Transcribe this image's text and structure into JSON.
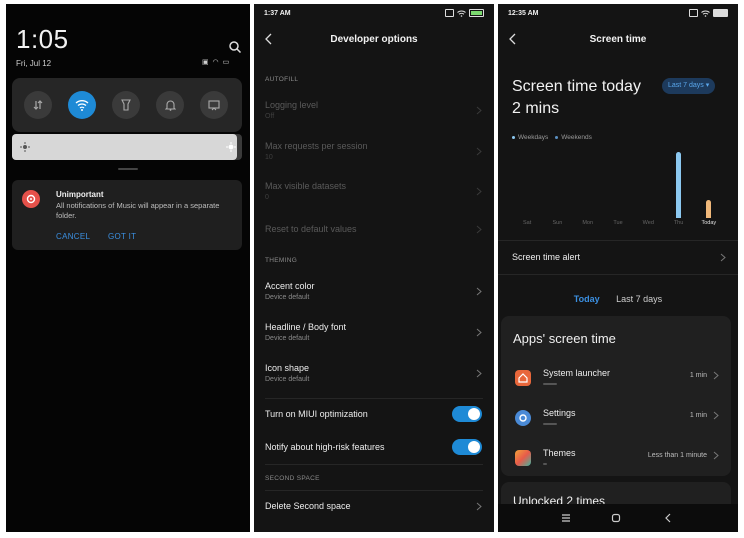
{
  "panel1": {
    "time": "1:05",
    "date": "Fri, Jul 12",
    "quick_settings": [
      "data-icon",
      "wifi-icon",
      "flashlight-icon",
      "bell-icon",
      "cast-icon"
    ],
    "brightness": 0.98,
    "notification": {
      "title": "Unimportant",
      "body": "All notifications of Music will appear in a separate folder.",
      "cancel": "CANCEL",
      "ok": "GOT IT"
    }
  },
  "panel2": {
    "status_time": "1:37 AM",
    "title": "Developer options",
    "autofill_header": "AUTOFILL",
    "logging_level": {
      "title": "Logging level",
      "sub": "Off"
    },
    "max_requests": {
      "title": "Max requests per session",
      "sub": "10"
    },
    "max_datasets": {
      "title": "Max visible datasets",
      "sub": "0"
    },
    "reset_defaults": "Reset to default values",
    "theming_header": "THEMING",
    "accent_color": {
      "title": "Accent color",
      "sub": "Device default"
    },
    "headline_font": {
      "title": "Headline / Body font",
      "sub": "Device default"
    },
    "icon_shape": {
      "title": "Icon shape",
      "sub": "Device default"
    },
    "miui_opt": "Turn on MIUI optimization",
    "high_risk": "Notify about high-risk features",
    "second_space_header": "SECOND SPACE",
    "delete_second_space": "Delete Second space"
  },
  "panel3": {
    "status_time": "12:35 AM",
    "title": "Screen time",
    "heading_line1": "Screen time today",
    "heading_line2": "2 mins",
    "range_pill": "Last 7 days ▾",
    "legend_weekdays": "Weekdays",
    "legend_weekends": "Weekends",
    "colors": {
      "weekdays": "#8cc8f0",
      "today": "#f0b87a"
    },
    "screen_time_alert": "Screen time alert",
    "tab_today": "Today",
    "tab_last7": "Last 7 days",
    "apps_title": "Apps' screen time",
    "apps": [
      {
        "name": "System launcher",
        "time": "1 min",
        "icon": "launcher-icon",
        "color": "#e8673b"
      },
      {
        "name": "Settings",
        "time": "1 min",
        "icon": "settings-icon",
        "color": "#4a8ad6"
      },
      {
        "name": "Themes",
        "time": "Less than 1 minute",
        "icon": "themes-icon",
        "color": "#e85b4a"
      }
    ],
    "unlocked": "Unlocked 2 times"
  },
  "chart_data": {
    "type": "bar",
    "categories": [
      "Sat",
      "Sun",
      "Mon",
      "Tue",
      "Wed",
      "Thu",
      "Today"
    ],
    "values": [
      0,
      0,
      0,
      0,
      0,
      58,
      16
    ],
    "title": "",
    "xlabel": "",
    "ylabel": "",
    "grid": false
  }
}
